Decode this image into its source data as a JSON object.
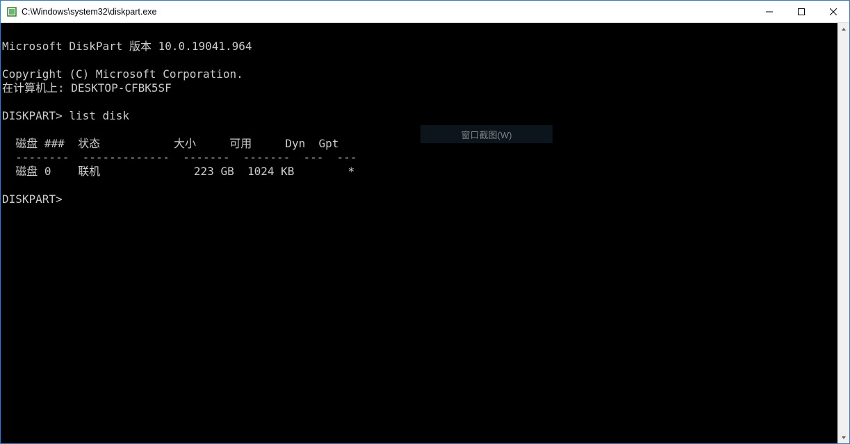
{
  "window": {
    "title": "C:\\Windows\\system32\\diskpart.exe"
  },
  "terminal": {
    "line1": "",
    "line2": "Microsoft DiskPart 版本 10.0.19041.964",
    "line3": "",
    "line4": "Copyright (C) Microsoft Corporation.",
    "line5": "在计算机上: DESKTOP-CFBK5SF",
    "line6": "",
    "line7": "DISKPART> list disk",
    "line8": "",
    "line9": "  磁盘 ###  状态           大小     可用     Dyn  Gpt",
    "line10": "  --------  -------------  -------  -------  ---  ---",
    "line11": "  磁盘 0    联机              223 GB  1024 KB        *",
    "line12": "",
    "line13": "DISKPART>"
  },
  "overlay": {
    "hint": "窗口截图(W)"
  }
}
